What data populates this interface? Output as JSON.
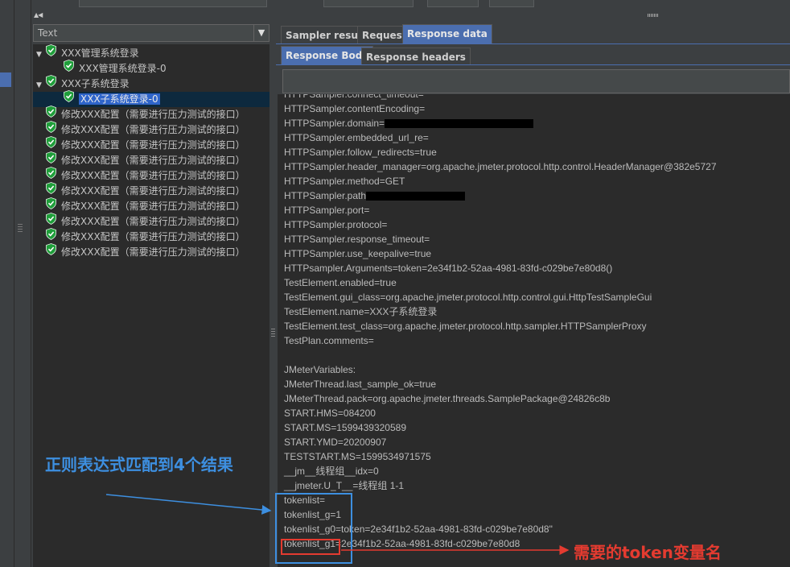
{
  "combo": {
    "value": "Text"
  },
  "tree": [
    {
      "label": "XXX管理系统登录",
      "level": 0,
      "expand": "▼"
    },
    {
      "label": "XXX管理系统登录-0",
      "level": 1,
      "expand": ""
    },
    {
      "label": "XXX子系统登录",
      "level": 0,
      "expand": "▼"
    },
    {
      "label": "XXX子系统登录-0",
      "level": 1,
      "expand": "",
      "selected": true
    },
    {
      "label": "修改XXX配置（需要进行压力测试的接口）",
      "level": 0,
      "expand": ""
    },
    {
      "label": "修改XXX配置（需要进行压力测试的接口）",
      "level": 0,
      "expand": ""
    },
    {
      "label": "修改XXX配置（需要进行压力测试的接口）",
      "level": 0,
      "expand": ""
    },
    {
      "label": "修改XXX配置（需要进行压力测试的接口）",
      "level": 0,
      "expand": ""
    },
    {
      "label": "修改XXX配置（需要进行压力测试的接口）",
      "level": 0,
      "expand": ""
    },
    {
      "label": "修改XXX配置（需要进行压力测试的接口）",
      "level": 0,
      "expand": ""
    },
    {
      "label": "修改XXX配置（需要进行压力测试的接口）",
      "level": 0,
      "expand": ""
    },
    {
      "label": "修改XXX配置（需要进行压力测试的接口）",
      "level": 0,
      "expand": ""
    },
    {
      "label": "修改XXX配置（需要进行压力测试的接口）",
      "level": 0,
      "expand": ""
    },
    {
      "label": "修改XXX配置（需要进行压力测试的接口）",
      "level": 0,
      "expand": ""
    }
  ],
  "tabs": [
    "Sampler result",
    "Request",
    "Response data"
  ],
  "subtabs": [
    "Response Body",
    "Response headers"
  ],
  "response_lines": [
    {
      "text": "HTTPSampler.contentEncoding="
    },
    {
      "text": "HTTPSampler.domain=",
      "redact": true
    },
    {
      "text": "HTTPSampler.embedded_url_re="
    },
    {
      "text": "HTTPSampler.follow_redirects=true"
    },
    {
      "text": "HTTPSampler.header_manager=org.apache.jmeter.protocol.http.control.HeaderManager@382e5727"
    },
    {
      "text": "HTTPSampler.method=GET"
    },
    {
      "text": "HTTPSampler.path",
      "redact": true
    },
    {
      "text": "HTTPSampler.port="
    },
    {
      "text": "HTTPSampler.protocol="
    },
    {
      "text": "HTTPSampler.response_timeout="
    },
    {
      "text": "HTTPSampler.use_keepalive=true"
    },
    {
      "text": "HTTPsampler.Arguments=token=2e34f1b2-52aa-4981-83fd-c029be7e80d8()"
    },
    {
      "text": "TestElement.enabled=true"
    },
    {
      "text": "TestElement.gui_class=org.apache.jmeter.protocol.http.control.gui.HttpTestSampleGui"
    },
    {
      "text": "TestElement.name=XXX子系统登录"
    },
    {
      "text": "TestElement.test_class=org.apache.jmeter.protocol.http.sampler.HTTPSamplerProxy"
    },
    {
      "text": "TestPlan.comments="
    },
    {
      "text": ""
    },
    {
      "text": "JMeterVariables:"
    },
    {
      "text": "JMeterThread.last_sample_ok=true"
    },
    {
      "text": "JMeterThread.pack=org.apache.jmeter.threads.SamplePackage@24826c8b"
    },
    {
      "text": "START.HMS=084200"
    },
    {
      "text": "START.MS=1599439320589"
    },
    {
      "text": "START.YMD=20200907"
    },
    {
      "text": "TESTSTART.MS=1599534971575"
    },
    {
      "text": "__jm__线程组__idx=0"
    },
    {
      "text": "__jmeter.U_T__=线程组 1-1"
    },
    {
      "text": "tokenlist="
    },
    {
      "text": "tokenlist_g=1"
    },
    {
      "text": "tokenlist_g0=token=2e34f1b2-52aa-4981-83fd-c029be7e80d8\""
    },
    {
      "text": "tokenlist_g1=2e34f1b2-52aa-4981-83fd-c029be7e80d8"
    }
  ],
  "annotations": {
    "blue_text": "正则表达式匹配到4个结果",
    "red_text": "需要的token变量名",
    "blue_color": "#3d8fe0",
    "red_color": "#e43b30"
  },
  "icons": {
    "tree_node": "green-shield-check-icon"
  }
}
